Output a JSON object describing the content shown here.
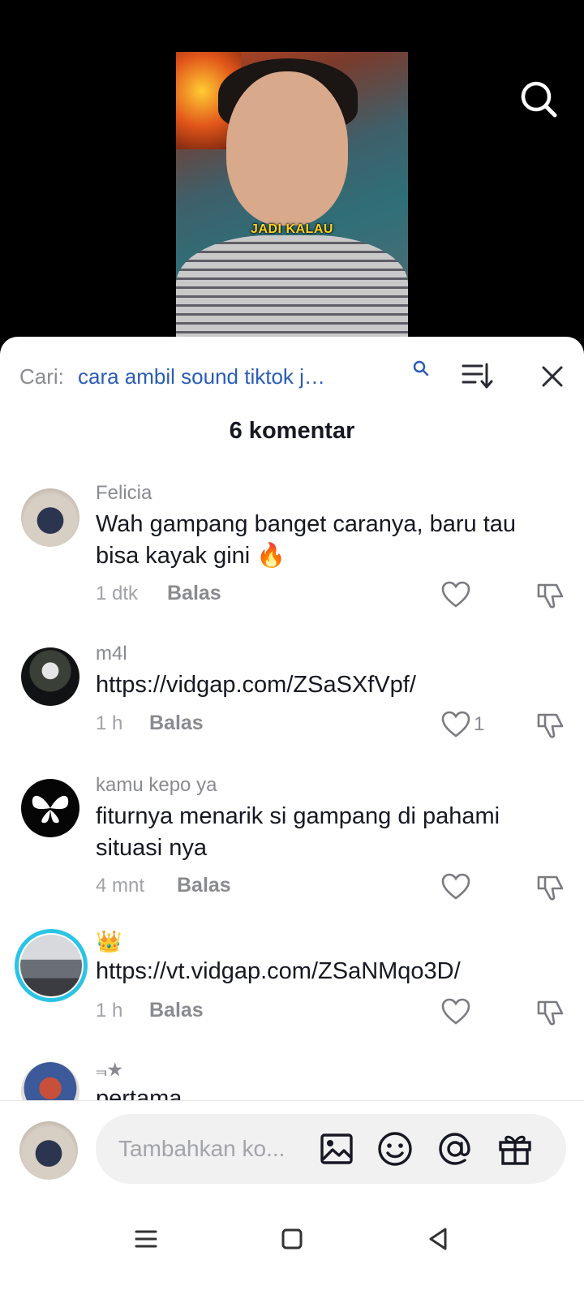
{
  "video": {
    "caption": "JADI KALAU",
    "search_icon": "search-icon"
  },
  "comments_sheet": {
    "search_prefix": "Cari:",
    "search_query": "cara ambil sound tiktok jadi a...",
    "sort_icon": "sort-icon",
    "close_icon": "close-icon",
    "count_label": "6 komentar",
    "comments": [
      {
        "username": "Felicia",
        "text_line1": "Wah gampang banget caranya, baru tau",
        "text_line2": "bisa kayak gini 🔥",
        "time": "1 dtk",
        "reply": "Balas",
        "likes": ""
      },
      {
        "username": "m4l",
        "text_line1": "https://vidgap.com/ZSaSXfVpf/",
        "text_line2": "",
        "time": "1 h",
        "reply": "Balas",
        "likes": "1"
      },
      {
        "username": "kamu kepo ya",
        "text_line1": "fiturnya menarik si gampang di pahami",
        "text_line2": "situasi nya",
        "time": "4 mnt",
        "reply": "Balas",
        "likes": ""
      },
      {
        "username": "👑",
        "text_line1": "https://vt.vidgap.com/ZSaNMqo3D/",
        "text_line2": "",
        "time": "1 h",
        "reply": "Balas",
        "likes": ""
      },
      {
        "username": "⫬★",
        "text_line1": "pertama",
        "text_line2": "",
        "time": "",
        "reply": "",
        "likes": ""
      }
    ]
  },
  "composer": {
    "placeholder": "Tambahkan ko...",
    "icons": [
      "image-icon",
      "emoji-icon",
      "mention-icon",
      "gift-icon"
    ]
  },
  "navbar": {
    "icons": [
      "menu-icon",
      "home-icon",
      "back-icon"
    ]
  },
  "colors": {
    "accent_blue": "#2a5cb8",
    "story_ring": "#2bc4e6",
    "text_primary": "#161823",
    "text_secondary": "#8a8b91"
  }
}
